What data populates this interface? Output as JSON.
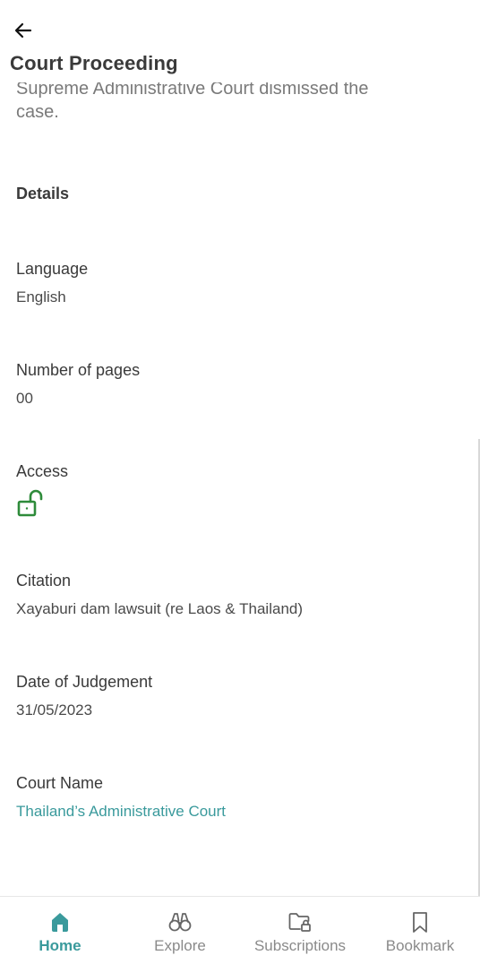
{
  "header": {
    "title": "Court Proceeding",
    "back_icon": "arrow-left-icon"
  },
  "intro": {
    "partial_line": "Supreme Administrative Court dismissed the",
    "last_line": "case."
  },
  "details": {
    "heading": "Details",
    "fields": [
      {
        "label": "Language",
        "value": "English"
      },
      {
        "label": "Number of pages",
        "value": "00"
      },
      {
        "label": "Access",
        "icon": "unlock-icon"
      },
      {
        "label": "Citation",
        "value": "Xayaburi dam lawsuit (re Laos & Thailand)"
      },
      {
        "label": "Date of Judgement",
        "value": "31/05/2023"
      },
      {
        "label": "Court Name",
        "value": "Thailand’s Administrative Court"
      }
    ]
  },
  "colors": {
    "accent": "#3a9a9c",
    "access_icon": "#2e8b3a",
    "text": "#3a3a3a",
    "muted": "#8a8a8a"
  },
  "bottom_nav": {
    "items": [
      {
        "label": "Home",
        "icon": "home-icon",
        "active": true
      },
      {
        "label": "Explore",
        "icon": "binoculars-icon",
        "active": false
      },
      {
        "label": "Subscriptions",
        "icon": "folder-lock-icon",
        "active": false
      },
      {
        "label": "Bookmark",
        "icon": "bookmark-icon",
        "active": false
      }
    ]
  }
}
